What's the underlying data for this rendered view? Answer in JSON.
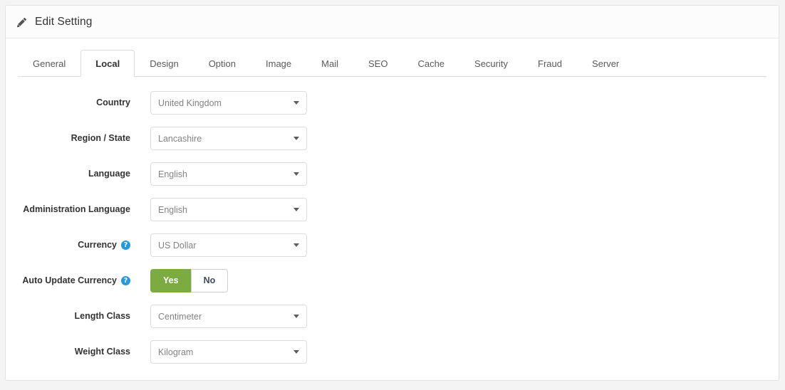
{
  "header": {
    "icon": "pencil-icon",
    "title": "Edit Setting"
  },
  "tabs": [
    {
      "label": "General",
      "active": false
    },
    {
      "label": "Local",
      "active": true
    },
    {
      "label": "Design",
      "active": false
    },
    {
      "label": "Option",
      "active": false
    },
    {
      "label": "Image",
      "active": false
    },
    {
      "label": "Mail",
      "active": false
    },
    {
      "label": "SEO",
      "active": false
    },
    {
      "label": "Cache",
      "active": false
    },
    {
      "label": "Security",
      "active": false
    },
    {
      "label": "Fraud",
      "active": false
    },
    {
      "label": "Server",
      "active": false
    }
  ],
  "form": {
    "fields": [
      {
        "label": "Country",
        "value": "United Kingdom",
        "help": false
      },
      {
        "label": "Region / State",
        "value": "Lancashire",
        "help": false
      },
      {
        "label": "Language",
        "value": "English",
        "help": false
      },
      {
        "label": "Administration Language",
        "value": "English",
        "help": false
      },
      {
        "label": "Currency",
        "value": "US Dollar",
        "help": true
      },
      {
        "label": "Length Class",
        "value": "Centimeter",
        "help": false
      },
      {
        "label": "Weight Class",
        "value": "Kilogram",
        "help": false
      }
    ],
    "auto_update_currency": {
      "label": "Auto Update Currency",
      "help": true,
      "help_glyph": "?",
      "options": [
        {
          "label": "Yes",
          "selected": true
        },
        {
          "label": "No",
          "selected": false
        }
      ]
    }
  },
  "colors": {
    "accent_green": "#7cab42",
    "help_blue": "#2799d8",
    "panel_border": "#e3e3e3",
    "page_background": "#f4f4f4"
  }
}
